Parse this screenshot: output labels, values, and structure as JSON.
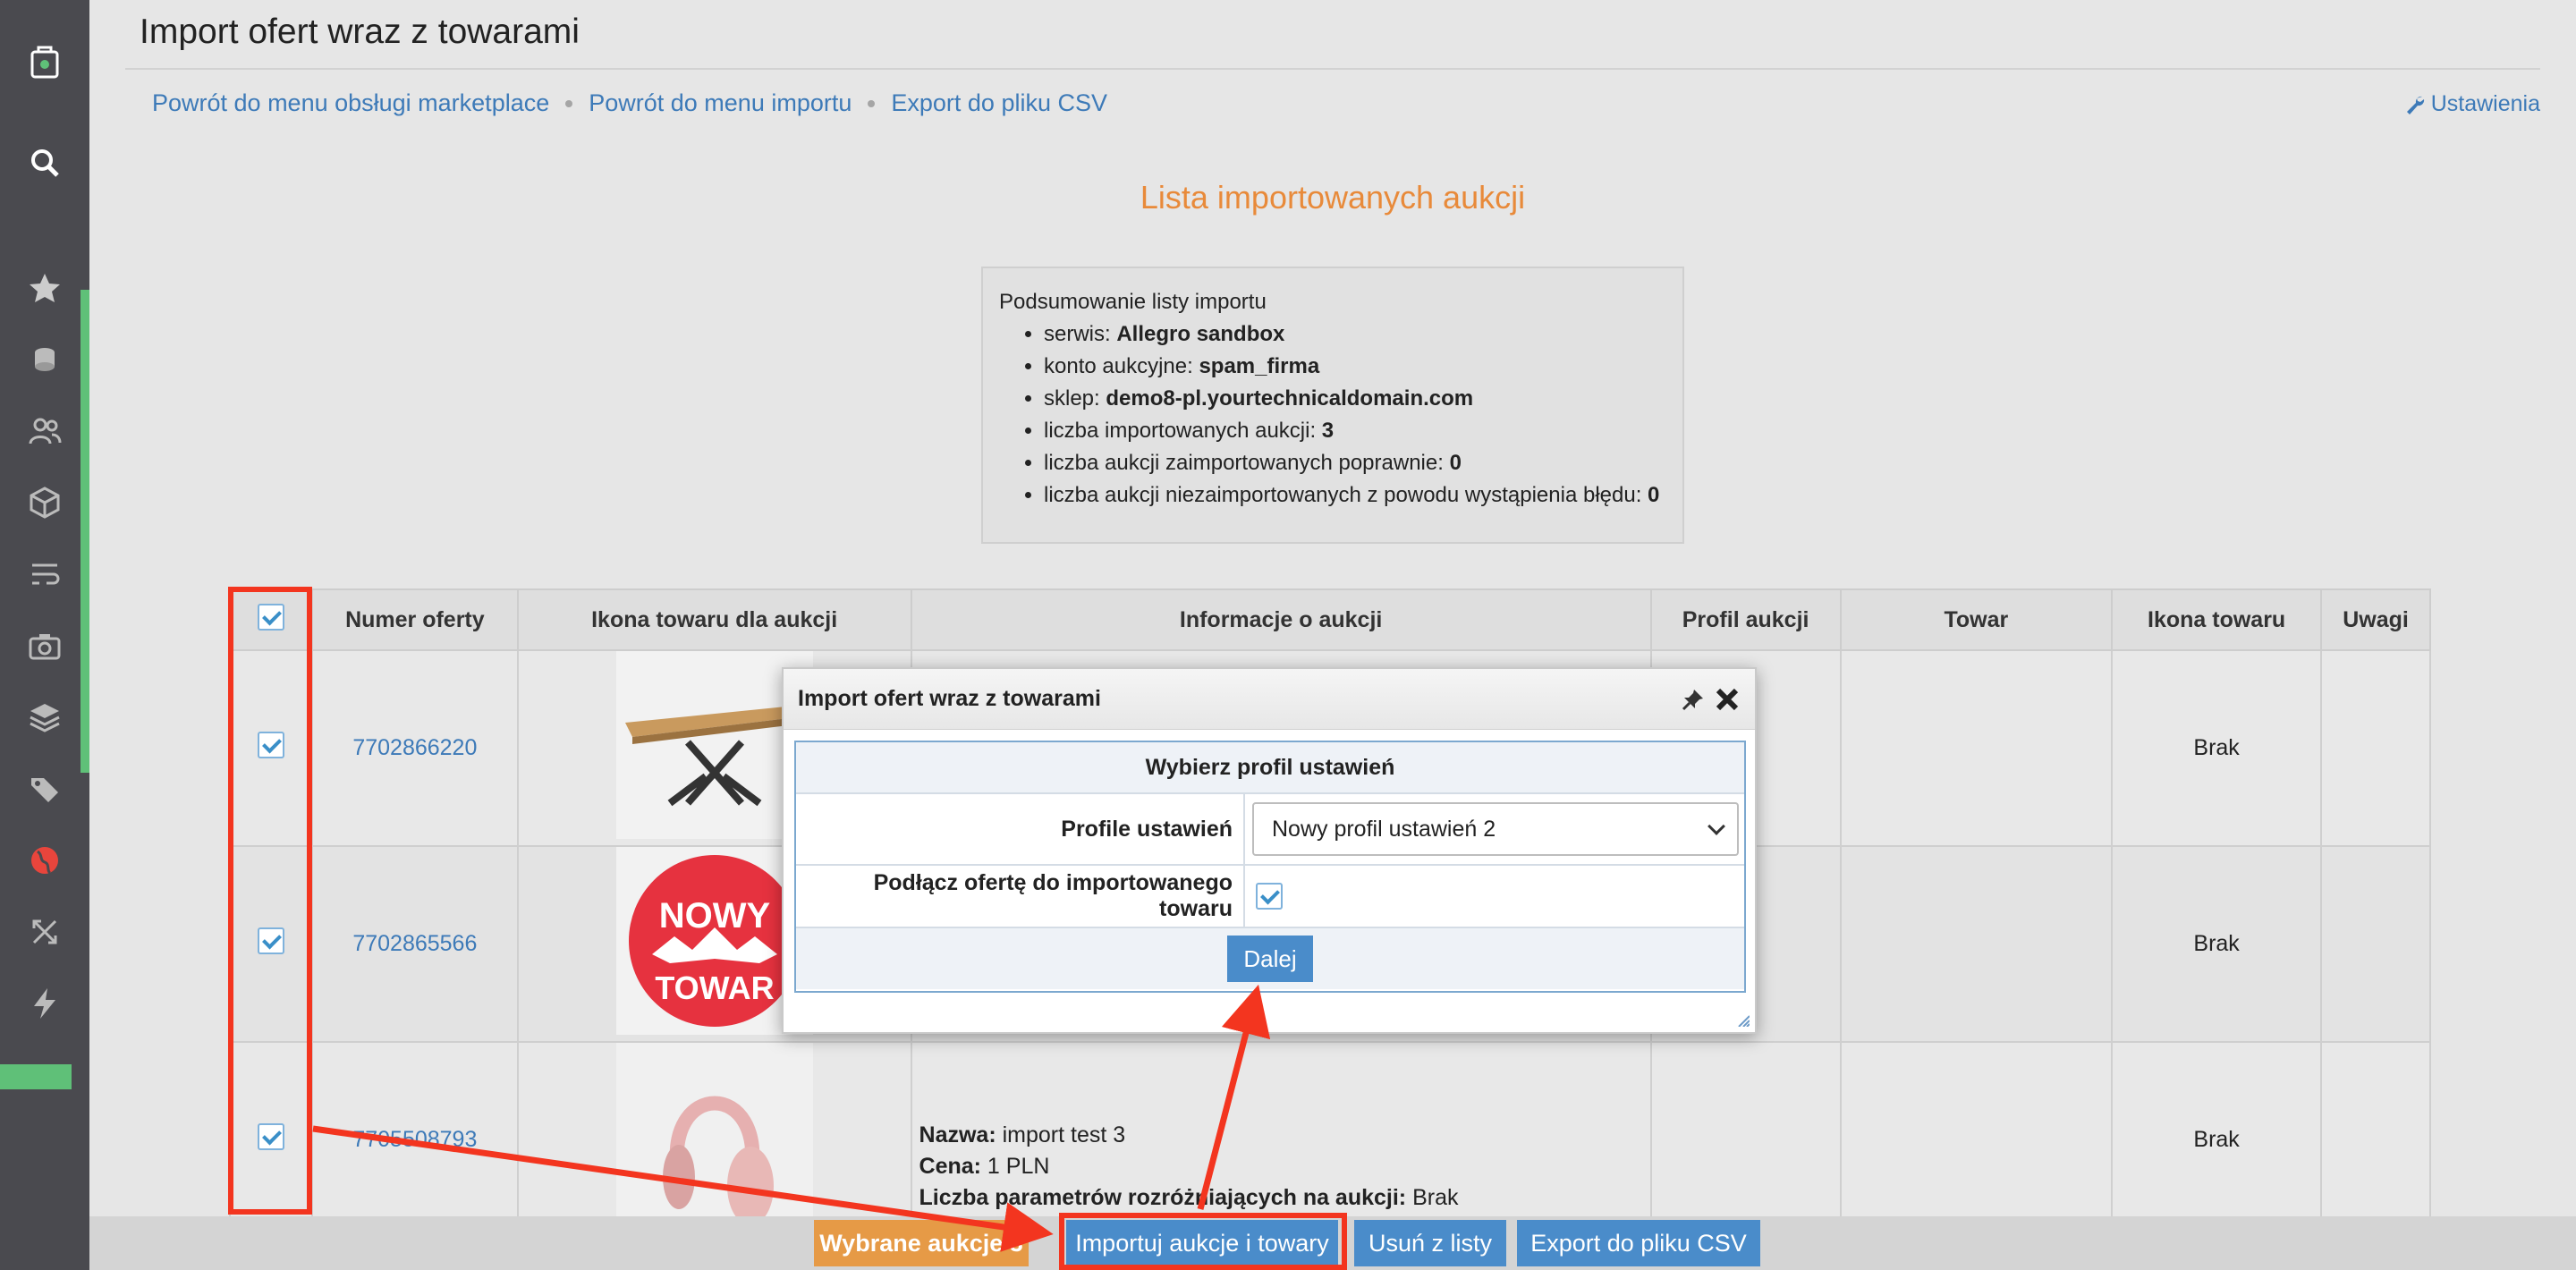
{
  "page": {
    "title": "Import ofert wraz z towarami",
    "list_title": "Lista importowanych aukcji"
  },
  "breadcrumbs": [
    "Powrót do menu obsługi marketplace",
    "Powrót do menu importu",
    "Export do pliku CSV"
  ],
  "settings_label": "Ustawienia",
  "summary": {
    "heading": "Podsumowanie listy importu",
    "items": [
      {
        "label": "serwis: ",
        "value": "Allegro sandbox"
      },
      {
        "label": "konto aukcyjne: ",
        "value": "spam_firma"
      },
      {
        "label": "sklep: ",
        "value": "demo8-pl.yourtechnicaldomain.com"
      },
      {
        "label": "liczba importowanych aukcji: ",
        "value": "3"
      },
      {
        "label": "liczba aukcji zaimportowanych poprawnie: ",
        "value": "0"
      },
      {
        "label": "liczba aukcji niezaimportowanych z powodu wystąpienia błędu: ",
        "value": "0"
      }
    ]
  },
  "table": {
    "headers": [
      "Numer oferty",
      "Ikona towaru dla aukcji",
      "Informacje o aukcji",
      "Profil aukcji",
      "Towar",
      "Ikona towaru",
      "Uwagi"
    ],
    "rows": [
      {
        "offer": "7702866220",
        "icon": "Brak"
      },
      {
        "offer": "7702865566",
        "icon": "Brak"
      },
      {
        "offer": "7705508793",
        "icon": "Brak",
        "info": [
          {
            "label": "Nazwa:",
            "value": " import test 3"
          },
          {
            "label": "Cena:",
            "value": " 1 PLN"
          },
          {
            "label": "Liczba parametrów rozróżniających na aukcji:",
            "value": " Brak"
          }
        ]
      }
    ]
  },
  "product_images": {
    "badge_line1": "NOWY",
    "badge_line2": "TOWAR"
  },
  "bottom": {
    "selected": "Wybrane aukcje 3",
    "import": "Importuj aukcje i towary",
    "remove": "Usuń z listy",
    "export": "Export do pliku CSV"
  },
  "modal": {
    "title": "Import ofert wraz z towarami",
    "section": "Wybierz profil ustawień",
    "profile_label": "Profile ustawień",
    "profile_value": "Nowy profil ustawień 2",
    "connect_label": "Podłącz ofertę do importowanego towaru",
    "next": "Dalej"
  },
  "colors": {
    "accent_blue": "#4a8cca",
    "link_blue": "#3d7ab8",
    "orange": "#e88a3a",
    "annotation_red": "#f3351f",
    "sidebar_green": "#5fc078"
  }
}
